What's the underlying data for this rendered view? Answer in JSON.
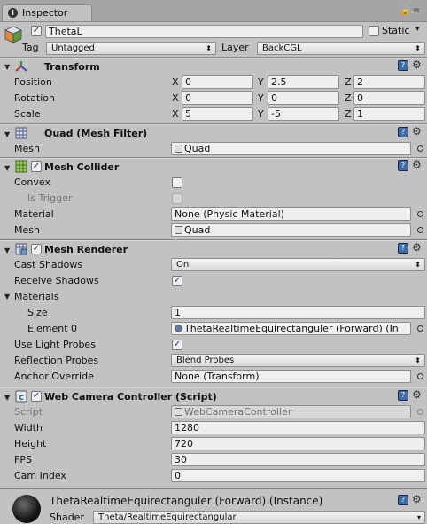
{
  "window": {
    "tab_label": "Inspector"
  },
  "header": {
    "object_name": "ThetaL",
    "static_label": "Static",
    "tag_label": "Tag",
    "tag_value": "Untagged",
    "layer_label": "Layer",
    "layer_value": "BackCGL"
  },
  "transform": {
    "title": "Transform",
    "position_label": "Position",
    "rotation_label": "Rotation",
    "scale_label": "Scale",
    "axis_x": "X",
    "axis_y": "Y",
    "axis_z": "Z",
    "position": {
      "x": "0",
      "y": "2.5",
      "z": "2"
    },
    "rotation": {
      "x": "0",
      "y": "0",
      "z": "0"
    },
    "scale": {
      "x": "5",
      "y": "-5",
      "z": "1"
    }
  },
  "mesh_filter": {
    "title": "Quad (Mesh Filter)",
    "mesh_label": "Mesh",
    "mesh_value": "Quad"
  },
  "mesh_collider": {
    "title": "Mesh Collider",
    "convex_label": "Convex",
    "is_trigger_label": "Is Trigger",
    "material_label": "Material",
    "material_value": "None (Physic Material)",
    "mesh_label": "Mesh",
    "mesh_value": "Quad"
  },
  "mesh_renderer": {
    "title": "Mesh Renderer",
    "cast_shadows_label": "Cast Shadows",
    "cast_shadows_value": "On",
    "receive_shadows_label": "Receive Shadows",
    "materials_label": "Materials",
    "size_label": "Size",
    "size_value": "1",
    "element0_label": "Element 0",
    "element0_value": "ThetaRealtimeEquirectanguler (Forward) (In",
    "light_probes_label": "Use Light Probes",
    "reflection_probes_label": "Reflection Probes",
    "reflection_probes_value": "Blend Probes",
    "anchor_override_label": "Anchor Override",
    "anchor_override_value": "None (Transform)"
  },
  "web_camera": {
    "title": "Web Camera Controller (Script)",
    "script_label": "Script",
    "script_value": "WebCameraController",
    "width_label": "Width",
    "width_value": "1280",
    "height_label": "Height",
    "height_value": "720",
    "fps_label": "FPS",
    "fps_value": "30",
    "cam_index_label": "Cam Index",
    "cam_index_value": "0"
  },
  "material": {
    "title": "ThetaRealtimeEquirectanguler (Forward) (Instance)",
    "shader_label": "Shader",
    "shader_value": "Theta/RealtimeEquirectangular"
  },
  "icons": {
    "checkmark": "✓",
    "help": "?",
    "gear": "⚙",
    "fold_open": "▼",
    "dropdown": "▾",
    "updown": "⬍"
  }
}
